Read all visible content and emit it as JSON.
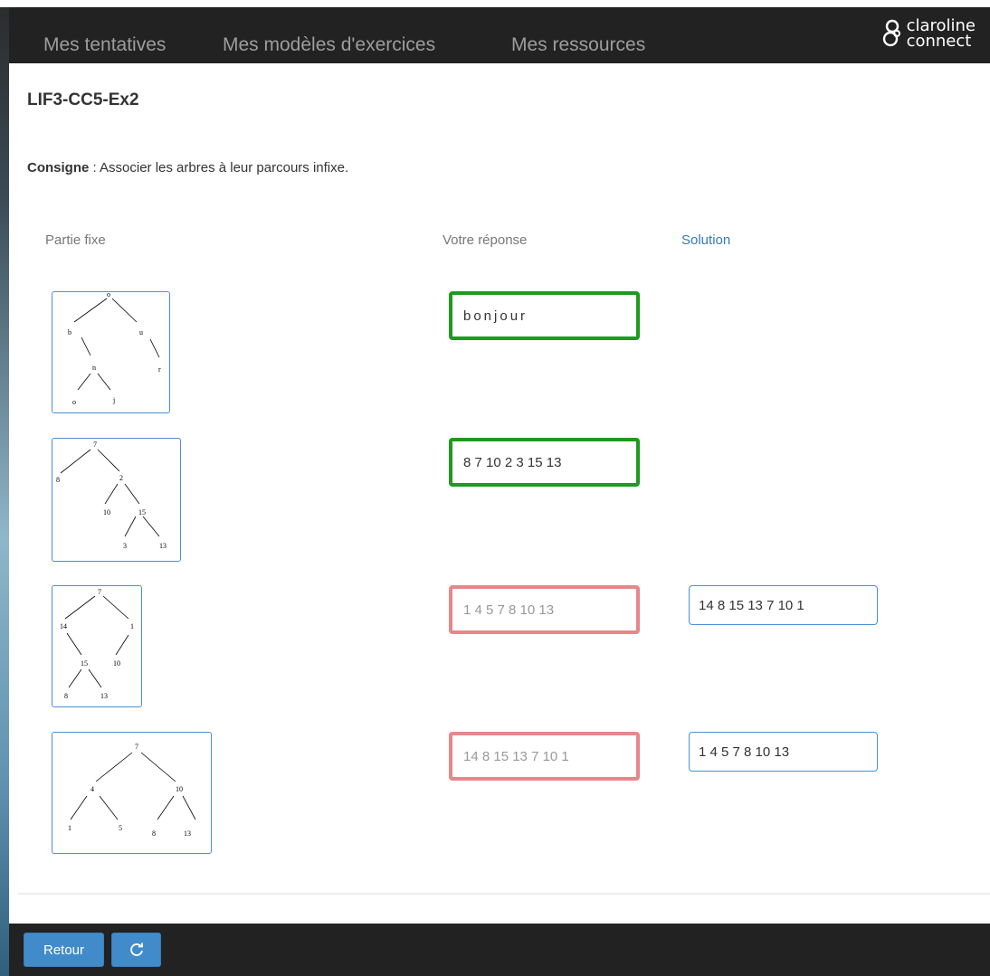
{
  "nav": {
    "items": [
      "Mes tentatives",
      "Mes modèles d'exercices",
      "Mes ressources"
    ],
    "logo": {
      "line1": "claroline",
      "line2": "connect"
    }
  },
  "exercise": {
    "title": "LIF3-CC5-Ex2",
    "consigne_label": "Consigne",
    "consigne_text": " : Associer les arbres à leur parcours infixe."
  },
  "columns": {
    "fixed": "Partie fixe",
    "answer": "Votre réponse",
    "solution": "Solution"
  },
  "rows": [
    {
      "nodes": [
        "o",
        "b",
        "u",
        "n",
        "r",
        "o",
        "j"
      ],
      "answer": "bonjour",
      "status": "correct",
      "solution": ""
    },
    {
      "nodes": [
        "7",
        "8",
        "2",
        "10",
        "15",
        "3",
        "13"
      ],
      "answer": "8 7 10 2 3 15 13",
      "status": "correct",
      "solution": ""
    },
    {
      "nodes": [
        "7",
        "14",
        "1",
        "15",
        "10",
        "8",
        "13"
      ],
      "answer": "1 4 5 7 8 10 13",
      "status": "incorrect",
      "solution": "14 8 15 13 7 10 1"
    },
    {
      "nodes": [
        "7",
        "4",
        "10",
        "1",
        "5",
        "8",
        "13"
      ],
      "answer": "14 8 15 13 7 10 1",
      "status": "incorrect",
      "solution": "1 4 5 7 8 10 13"
    }
  ],
  "footer": {
    "back_label": "Retour",
    "retry_icon": "refresh-icon"
  },
  "colors": {
    "correct": "#1e9a1e",
    "incorrect": "#e8868a",
    "primary": "#428bca",
    "navbar": "#222222"
  }
}
